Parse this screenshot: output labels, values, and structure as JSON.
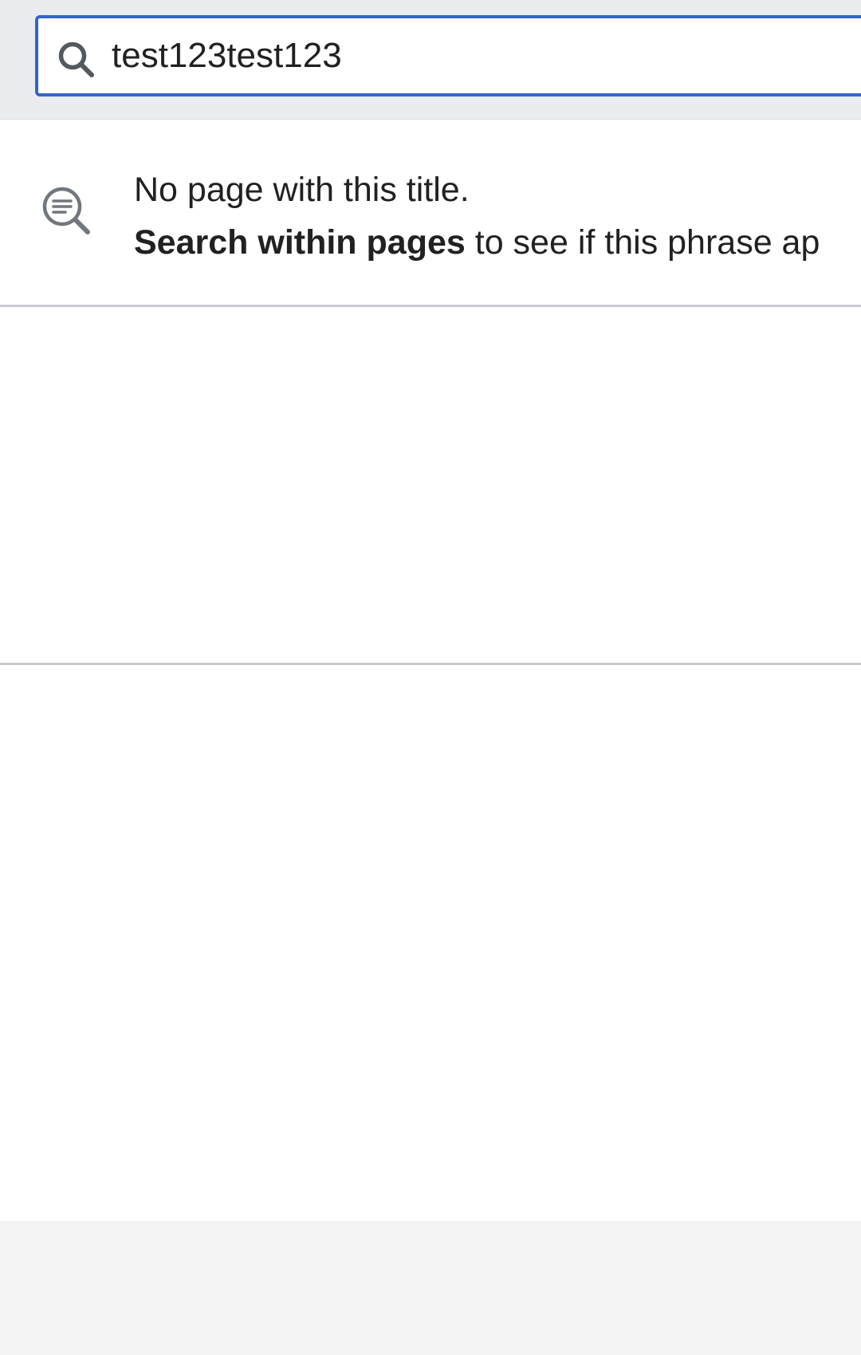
{
  "search": {
    "value": "test123test123",
    "icon": "search-icon"
  },
  "notice": {
    "icon": "search-in-text-icon",
    "title": "No page with this title.",
    "link_label": "Search within pages",
    "suffix": " to see if this phrase ap"
  },
  "colors": {
    "accent": "#3366cc",
    "header_bg": "#eaecf0",
    "divider": "#c8ccd1",
    "footer_bg": "#f3f3f4"
  }
}
